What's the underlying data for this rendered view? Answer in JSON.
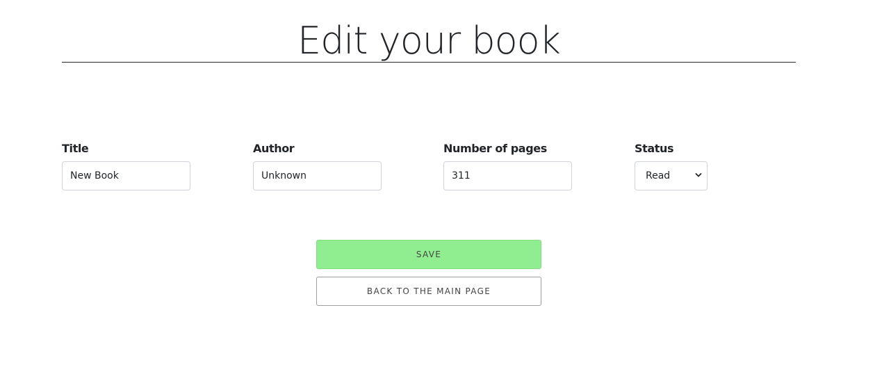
{
  "page": {
    "title": "Edit your book"
  },
  "form": {
    "title": {
      "label": "Title",
      "value": "New Book"
    },
    "author": {
      "label": "Author",
      "value": "Unknown"
    },
    "pages": {
      "label": "Number of pages",
      "value": "311"
    },
    "status": {
      "label": "Status",
      "value": "Read"
    }
  },
  "actions": {
    "save_label": "SAVE",
    "back_label": "BACK TO THE MAIN PAGE"
  },
  "colors": {
    "save_button": "#90ee90",
    "text": "#212529"
  },
  "icons": {
    "status_dropdown": "chevron-down-icon"
  }
}
